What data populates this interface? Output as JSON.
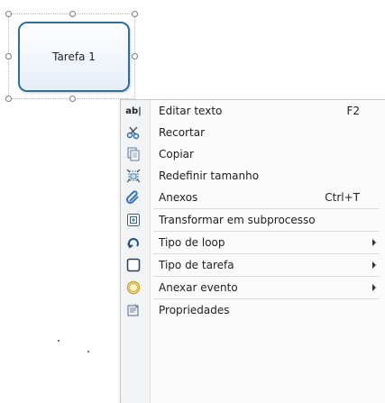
{
  "task": {
    "label": "Tarefa 1"
  },
  "menu": {
    "items": [
      {
        "icon": "edit-text-icon",
        "label": "Editar texto",
        "shortcut": "F2"
      },
      {
        "icon": "cut-icon",
        "label": "Recortar",
        "shortcut": ""
      },
      {
        "icon": "copy-icon",
        "label": "Copiar",
        "shortcut": ""
      },
      {
        "icon": "resize-icon",
        "label": "Redefinir tamanho",
        "shortcut": ""
      },
      {
        "icon": "attachment-icon",
        "label": "Anexos",
        "shortcut": "Ctrl+T"
      },
      {
        "icon": "subprocess-icon",
        "label": "Transformar em subprocesso",
        "shortcut": ""
      },
      {
        "icon": "loop-icon",
        "label": "Tipo de loop",
        "shortcut": "",
        "submenu": true
      },
      {
        "icon": "task-type-icon",
        "label": "Tipo de tarefa",
        "shortcut": "",
        "submenu": true
      },
      {
        "icon": "attach-event-icon",
        "label": "Anexar evento",
        "shortcut": "",
        "submenu": true
      },
      {
        "icon": "properties-icon",
        "label": "Propriedades",
        "shortcut": ""
      }
    ],
    "icon_glyphs": {
      "edit_text": "ab|"
    },
    "colors": {
      "accent": "#2f6f9a",
      "gutter": "#f1f3f5"
    }
  }
}
